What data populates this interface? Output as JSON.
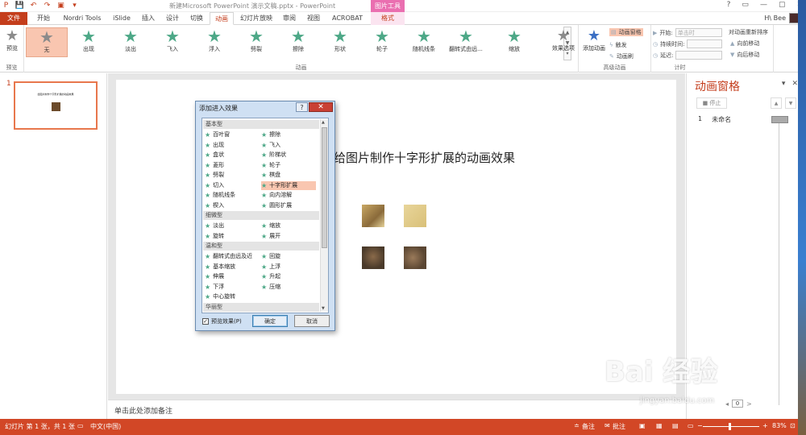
{
  "titlebar": {
    "doc_title": "新建Microsoft PowerPoint 演示文稿.pptx - PowerPoint",
    "context_group": "图片工具",
    "help": "?",
    "restore": "▭",
    "minimize": "—",
    "maximize": "▢",
    "close": "✕"
  },
  "tabs": {
    "file": "文件",
    "items": [
      "开始",
      "Nordri Tools",
      "iSlide",
      "插入",
      "设计",
      "切换",
      "动画",
      "幻灯片放映",
      "审阅",
      "视图",
      "ACROBAT",
      "格式"
    ],
    "user": "H\\ Bee"
  },
  "ribbon": {
    "preview_label": "预览",
    "preview_group": "预览",
    "effects": [
      "无",
      "出现",
      "淡出",
      "飞入",
      "浮入",
      "劈裂",
      "擦除",
      "形状",
      "轮子",
      "随机线条",
      "翻转式由远...",
      "缩放"
    ],
    "effect_options": "效果选项",
    "animation_group": "动画",
    "add_animation": "添加动画",
    "anim_pane": "动画窗格",
    "trigger": "触发",
    "anim_painter": "动画刷",
    "advanced_group": "高级动画",
    "start_label": "开始:",
    "start_value": "单击时",
    "duration_label": "持续时间:",
    "delay_label": "延迟:",
    "reorder_title": "对动画重新排序",
    "move_earlier": "向前移动",
    "move_later": "向后移动",
    "timing_group": "计时"
  },
  "thumbs": {
    "number": "1",
    "title": "给图片制作十字形扩展的动画效果"
  },
  "slide": {
    "title": "给图片制作十字形扩展的动画效果"
  },
  "notes": {
    "placeholder": "单击此处添加备注"
  },
  "pane": {
    "title": "动画窗格",
    "play": "停止",
    "item_index": "1",
    "item_name": "未命名",
    "scroll_left": "0",
    "scroll_right": ">"
  },
  "dialog": {
    "title": "添加进入效果",
    "help": "?",
    "close": "✕",
    "categories": [
      "基本型",
      "细微型",
      "温和型",
      "华丽型"
    ],
    "basic": [
      [
        "百叶窗",
        "擦除"
      ],
      [
        "出现",
        "飞入"
      ],
      [
        "盒状",
        "阶梯状"
      ],
      [
        "菱形",
        "轮子"
      ],
      [
        "劈裂",
        "棋盘"
      ],
      [
        "切入",
        "十字形扩展"
      ],
      [
        "随机线条",
        "向内溶解"
      ],
      [
        "楔入",
        "圆形扩展"
      ]
    ],
    "subtle": [
      [
        "淡出",
        "缩放"
      ],
      [
        "旋转",
        "展开"
      ]
    ],
    "moderate": [
      [
        "翻转式由远及近",
        "回旋"
      ],
      [
        "基本缩放",
        "上浮"
      ],
      [
        "伸展",
        "升起"
      ],
      [
        "下浮",
        "压缩"
      ],
      [
        "中心旋转",
        ""
      ]
    ],
    "preview_label": "预览效果(P)",
    "ok": "确定",
    "cancel": "取消",
    "selected": "十字形扩展"
  },
  "status": {
    "slide_info": "幻灯片 第 1 张，共 1 张",
    "language": "中文(中国)",
    "notes_btn": "备注",
    "comments_btn": "批注",
    "zoom": "83%"
  },
  "watermark": {
    "logo": "Bai 经验",
    "url": "jingyan.baidu.com"
  }
}
